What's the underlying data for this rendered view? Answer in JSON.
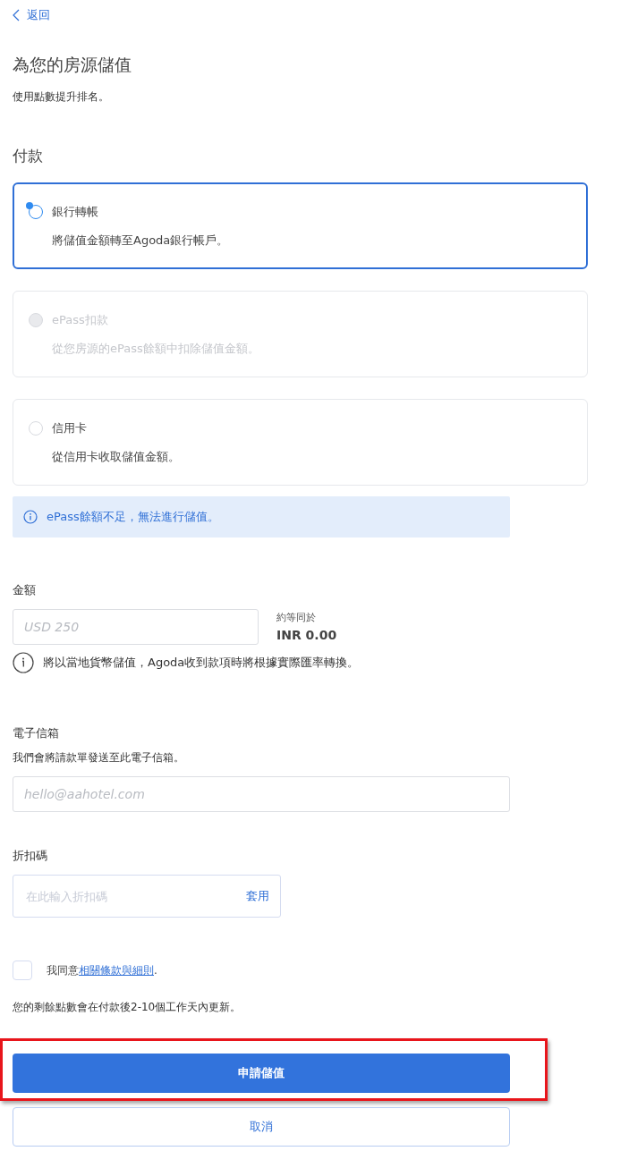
{
  "back_link": "返回",
  "title": "為您的房源儲值",
  "subtitle": "使用點數提升排名。",
  "payment": {
    "heading": "付款",
    "options": [
      {
        "label": "銀行轉帳",
        "description": "將儲值金額轉至Agoda銀行帳戶。",
        "selected": true,
        "disabled": false
      },
      {
        "label": "ePass扣款",
        "description": "從您房源的ePass餘額中扣除儲值金額。",
        "selected": false,
        "disabled": true
      },
      {
        "label": "信用卡",
        "description": "從信用卡收取儲值金額。",
        "selected": false,
        "disabled": false
      }
    ],
    "notice": "ePass餘額不足，無法進行儲值。"
  },
  "amount": {
    "label": "金額",
    "placeholder": "USD 250",
    "equivalent_label": "約等同於",
    "equivalent_value": "INR 0.00",
    "note": "將以當地貨幣儲值，Agoda收到款項時將根據實際匯率轉換。"
  },
  "email": {
    "label": "電子信箱",
    "hint": "我們會將請款單發送至此電子信箱。",
    "placeholder": "hello@aahotel.com"
  },
  "promo": {
    "label": "折扣碼",
    "placeholder": "在此輸入折扣碼",
    "apply": "套用"
  },
  "agreement": {
    "checked": false,
    "text": "我同意",
    "link": "相關條款與細則",
    "suffix": "."
  },
  "update_note": "您的剩餘點數會在付款後2-10個工作天內更新。",
  "buttons": {
    "submit": "申請儲值",
    "cancel": "取消"
  }
}
